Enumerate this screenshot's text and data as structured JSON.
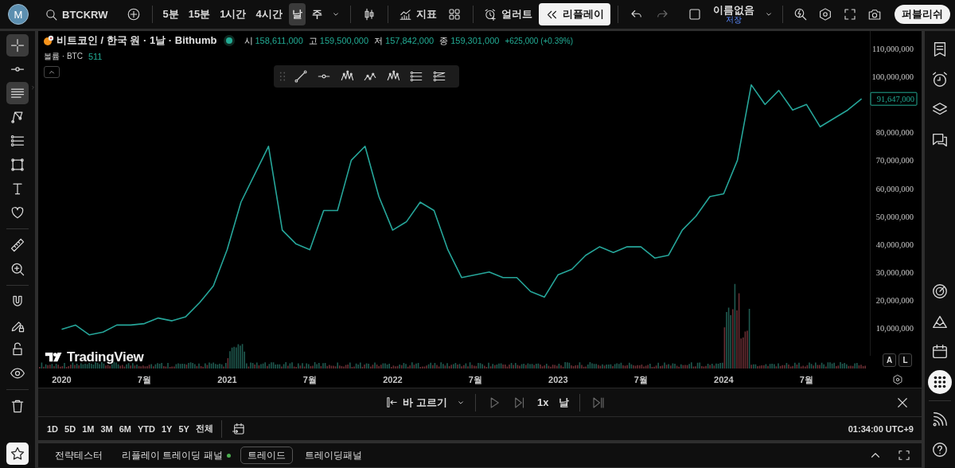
{
  "topbar": {
    "avatar": "M",
    "symbol": "BTCKRW",
    "intervals": [
      {
        "label": "5분",
        "selected": false
      },
      {
        "label": "15분",
        "selected": false
      },
      {
        "label": "1시간",
        "selected": false
      },
      {
        "label": "4시간",
        "selected": false
      },
      {
        "label": "날",
        "selected": true
      },
      {
        "label": "주",
        "selected": false
      }
    ],
    "indicators_label": "지표",
    "alert_label": "얼러트",
    "replay": {
      "label": "리플레이",
      "active": true
    },
    "layout": {
      "name": "이름없음",
      "status": "저장"
    },
    "publish_label": "퍼블리쉬"
  },
  "left_tools": [
    {
      "selected": true
    },
    {
      "selected": false
    },
    {
      "selected": true
    },
    {
      "selected": false
    },
    {
      "selected": false
    },
    {
      "selected": false
    },
    {
      "selected": false
    },
    {
      "selected": false
    },
    {
      "selected": false
    },
    {
      "selected": false
    },
    {
      "selected": false
    },
    {
      "selected": false
    },
    {
      "selected": false
    },
    {
      "selected": false
    },
    {
      "selected": false
    }
  ],
  "legend": {
    "title": "비트코인 / 한국 원 · 1날 · Bithumb",
    "market_open": true,
    "ohlc": [
      {
        "key": "시",
        "value": "158,611,000"
      },
      {
        "key": "고",
        "value": "159,500,000"
      },
      {
        "key": "저",
        "value": "157,842,000"
      },
      {
        "key": "종",
        "value": "159,301,000"
      }
    ],
    "change": "+625,000 (+0.39%)",
    "volume_label": "볼륨 · BTC",
    "volume_value": "511"
  },
  "chart": {
    "brand": "TradingView",
    "last_price": "91,647,000",
    "scale_buttons": [
      "A",
      "L"
    ],
    "chart_data": {
      "type": "line",
      "categories": [
        "2020",
        null,
        null,
        null,
        null,
        null,
        "7월",
        null,
        null,
        null,
        null,
        null,
        "2021",
        null,
        null,
        null,
        null,
        null,
        "7월",
        null,
        null,
        null,
        null,
        null,
        "2022",
        null,
        null,
        null,
        null,
        null,
        "7월",
        null,
        null,
        null,
        null,
        null,
        "2023",
        null,
        null,
        null,
        null,
        null,
        "7월",
        null,
        null,
        null,
        null,
        null,
        "2024",
        null,
        null,
        null,
        null,
        null,
        "7월",
        null,
        null,
        null,
        null
      ],
      "series": [
        {
          "color": "#26a69a",
          "values": [
            9500000,
            11000000,
            7500000,
            8500000,
            11000000,
            11000000,
            11500000,
            13500000,
            12500000,
            14000000,
            19000000,
            25000000,
            38000000,
            55000000,
            65000000,
            75000000,
            45000000,
            40000000,
            38000000,
            52000000,
            52000000,
            70000000,
            75000000,
            57000000,
            45000000,
            48000000,
            55000000,
            52000000,
            38000000,
            28000000,
            29000000,
            30000000,
            28000000,
            28000000,
            23000000,
            21000000,
            29000000,
            31000000,
            36000000,
            39000000,
            37000000,
            39000000,
            39000000,
            35000000,
            36000000,
            45000000,
            50000000,
            57000000,
            58000000,
            70000000,
            97000000,
            90000000,
            95000000,
            88000000,
            90000000,
            82000000,
            85000000,
            88000000,
            92000000
          ]
        }
      ],
      "ylim": [
        0,
        116270000
      ],
      "yticks": [
        {
          "value": 10000000,
          "label": "10,000,000"
        },
        {
          "value": 20000000,
          "label": "20,000,000"
        },
        {
          "value": 30000000,
          "label": "30,000,000"
        },
        {
          "value": 40000000,
          "label": "40,000,000"
        },
        {
          "value": 50000000,
          "label": "50,000,000"
        },
        {
          "value": 60000000,
          "label": "60,000,000"
        },
        {
          "value": 70000000,
          "label": "70,000,000"
        },
        {
          "value": 80000000,
          "label": "80,000,000"
        },
        {
          "value": 100000000,
          "label": "100,000,000"
        },
        {
          "value": 110000000,
          "label": "110,000,000"
        }
      ]
    }
  },
  "replay_bar": {
    "select_bar_label": "바 고르기",
    "speed": "1x",
    "interval": "날"
  },
  "range_bar": {
    "ranges": [
      "1D",
      "5D",
      "1M",
      "3M",
      "6M",
      "YTD",
      "1Y",
      "5Y",
      "전체"
    ],
    "clock": "01:34:00 UTC+9"
  },
  "right_tools": [
    {
      "selected": false
    },
    {
      "selected": false
    },
    {
      "selected": false
    },
    {
      "selected": false
    },
    {
      "selected": false
    },
    {
      "selected": false
    },
    {
      "selected": false
    },
    {
      "selected": true
    },
    {
      "selected": false
    },
    {
      "selected": false
    }
  ],
  "bottom_tabs": [
    {
      "label": "전략테스터",
      "selected": false,
      "live": false
    },
    {
      "label": "리플레이 트레이딩 패널",
      "selected": false,
      "live": true
    },
    {
      "label": "트레이드",
      "selected": true,
      "live": false
    },
    {
      "label": "트레이딩패널",
      "selected": false,
      "live": false
    }
  ]
}
